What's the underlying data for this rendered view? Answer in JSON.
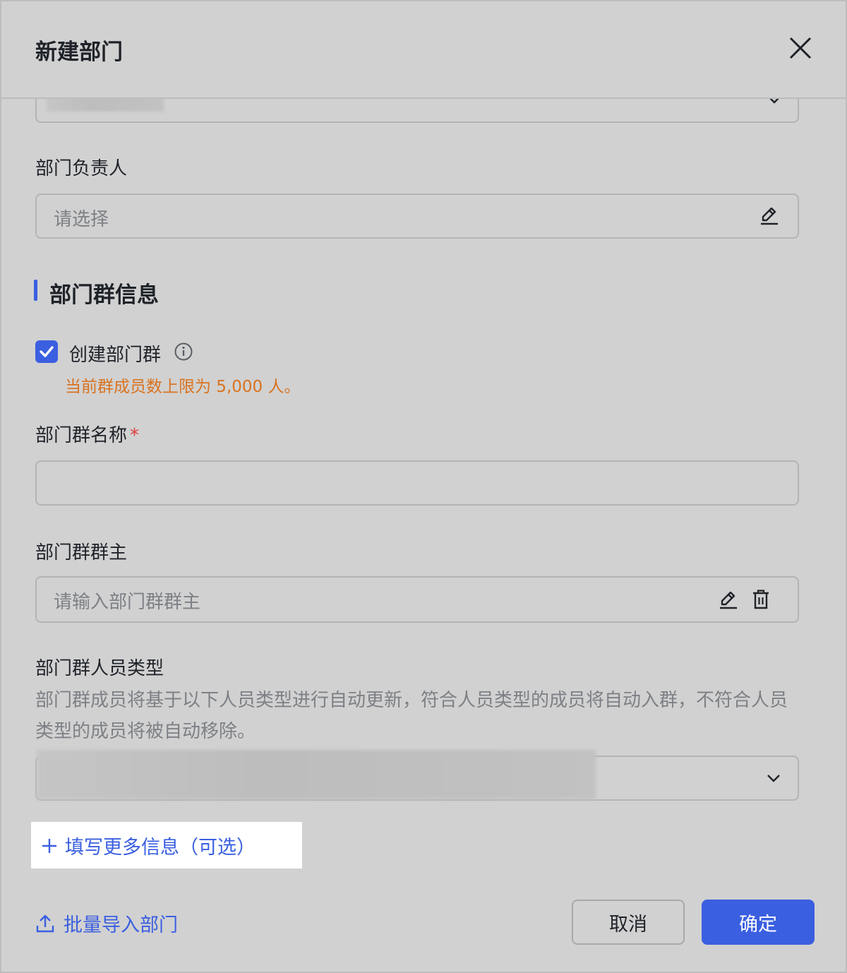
{
  "dialog": {
    "title": "新建部门"
  },
  "manager": {
    "label": "部门负责人",
    "placeholder": "请选择"
  },
  "group_section": {
    "title": "部门群信息",
    "create_group_label": "创建部门群",
    "create_group_checked": true,
    "member_limit_hint": "当前群成员数上限为 5,000 人。",
    "name_label": "部门群名称",
    "required_mark": "*",
    "name_value": "",
    "owner_label": "部门群群主",
    "owner_placeholder": "请输入部门群群主",
    "member_type_label": "部门群人员类型",
    "member_type_desc": "部门群成员将基于以下人员类型进行自动更新，符合人员类型的成员将自动入群，不符合人员类型的成员将被自动移除。"
  },
  "more_info_link": "填写更多信息（可选）",
  "footer": {
    "import_link": "批量导入部门",
    "cancel_label": "取消",
    "ok_label": "确定"
  },
  "colors": {
    "accent": "#3a5fe0",
    "warning": "#d9731f",
    "required": "#e03b3b"
  }
}
